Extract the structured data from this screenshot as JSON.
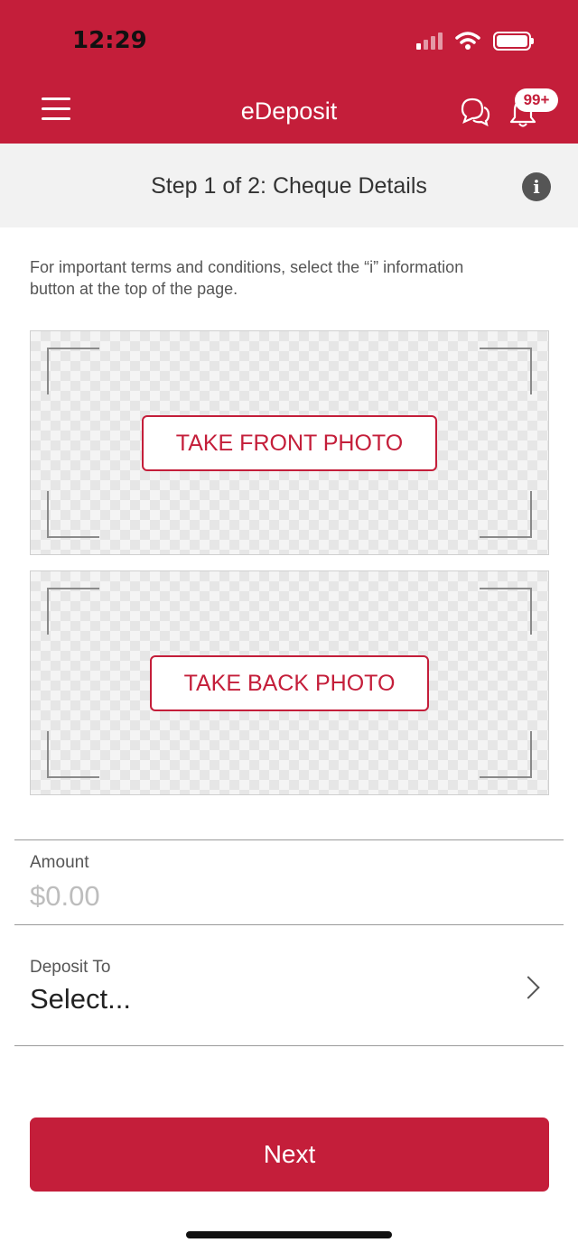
{
  "status_bar": {
    "time": "12:29"
  },
  "header": {
    "title": "eDeposit",
    "notification_badge": "99+",
    "brand_color": "#c41e3a"
  },
  "step": {
    "title": "Step 1 of 2: Cheque Details",
    "info_label": "i"
  },
  "terms_text": "For important terms and conditions, select the “i” information button at the top of the page.",
  "photos": {
    "front_label": "TAKE FRONT PHOTO",
    "back_label": "TAKE BACK PHOTO"
  },
  "amount": {
    "label": "Amount",
    "placeholder": "$0.00"
  },
  "deposit_to": {
    "label": "Deposit To",
    "value": "Select..."
  },
  "next_label": "Next",
  "icons": [
    "menu-icon",
    "chat-icon",
    "bell-icon",
    "info-icon",
    "chevron-right-icon",
    "signal-icon",
    "wifi-icon",
    "battery-icon"
  ]
}
